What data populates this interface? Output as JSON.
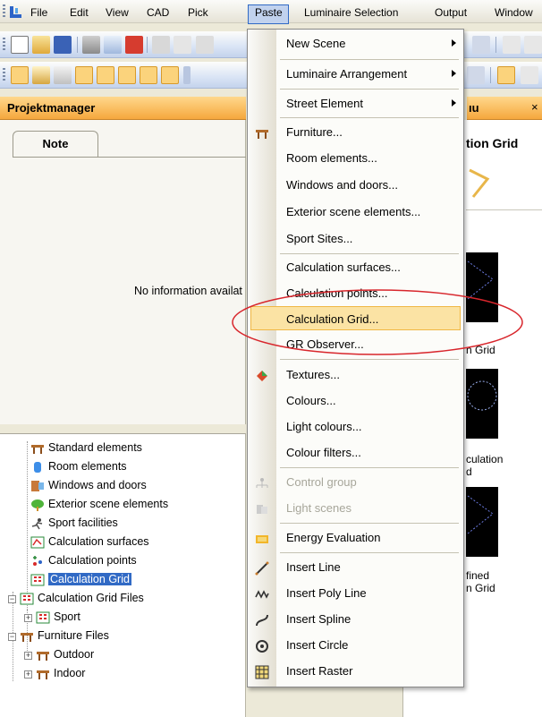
{
  "menubar": {
    "items": [
      "File",
      "Edit",
      "View",
      "CAD",
      "Pick",
      "Paste",
      "Luminaire Selection",
      "Output",
      "Window"
    ],
    "active": "Paste"
  },
  "project_manager": {
    "title": "Projektmanager",
    "tab_note": "Note",
    "empty_text": "No information availat"
  },
  "tree": {
    "items": [
      {
        "label": "Standard elements",
        "icon": "table-icon"
      },
      {
        "label": "Room elements",
        "icon": "cylinder-icon"
      },
      {
        "label": "Windows and doors",
        "icon": "window-icon"
      },
      {
        "label": "Exterior scene elements",
        "icon": "tree-icon"
      },
      {
        "label": "Sport facilities",
        "icon": "runner-icon"
      },
      {
        "label": "Calculation surfaces",
        "icon": "calc-surface-icon"
      },
      {
        "label": "Calculation points",
        "icon": "calc-points-icon"
      },
      {
        "label": "Calculation Grid",
        "icon": "calc-grid-icon",
        "selected": true
      },
      {
        "label": "Calculation Grid Files",
        "icon": "calc-grid-icon"
      },
      {
        "label": "Sport",
        "icon": "calc-grid-icon"
      },
      {
        "label": "Furniture Files",
        "icon": "table-icon"
      },
      {
        "label": "Outdoor",
        "icon": "table-icon"
      },
      {
        "label": "Indoor",
        "icon": "table-icon"
      }
    ]
  },
  "right_panel": {
    "header": "ıu",
    "title": "tion Grid",
    "labels": [
      "n Grid",
      "culation",
      "d",
      "fined",
      "n Grid"
    ]
  },
  "dropdown": {
    "items": [
      {
        "label": "New Scene",
        "submenu": true
      },
      {
        "label": "Luminaire Arrangement",
        "submenu": true
      },
      {
        "label": "Street Element",
        "submenu": true
      },
      {
        "label": "Furniture...",
        "icon": "table-icon"
      },
      {
        "label": "Room elements..."
      },
      {
        "label": "Windows and doors..."
      },
      {
        "label": "Exterior scene elements..."
      },
      {
        "label": "Sport Sites..."
      },
      {
        "label": "Calculation surfaces..."
      },
      {
        "label": "Calculation points..."
      },
      {
        "label": "Calculation Grid...",
        "highlighted": true
      },
      {
        "label": "GR Observer..."
      },
      {
        "label": "Textures...",
        "icon": "textures-icon"
      },
      {
        "label": "Colours..."
      },
      {
        "label": "Light colours..."
      },
      {
        "label": "Colour filters..."
      },
      {
        "label": "Control group",
        "disabled": true,
        "icon": "control-group-icon"
      },
      {
        "label": "Light scenes",
        "disabled": true,
        "icon": "light-scenes-icon"
      },
      {
        "label": "Energy Evaluation",
        "icon": "energy-icon"
      },
      {
        "label": "Insert Line",
        "icon": "line-icon"
      },
      {
        "label": "Insert Poly Line",
        "icon": "polyline-icon"
      },
      {
        "label": "Insert Spline",
        "icon": "spline-icon"
      },
      {
        "label": "Insert Circle",
        "icon": "circle-icon"
      },
      {
        "label": "Insert Raster",
        "icon": "raster-icon"
      }
    ]
  },
  "colors": {
    "accent": "#316ac5",
    "highlight": "#fbe3a4",
    "panel_header": "#f5a73d",
    "annotation_ellipse": "#d8262c"
  }
}
